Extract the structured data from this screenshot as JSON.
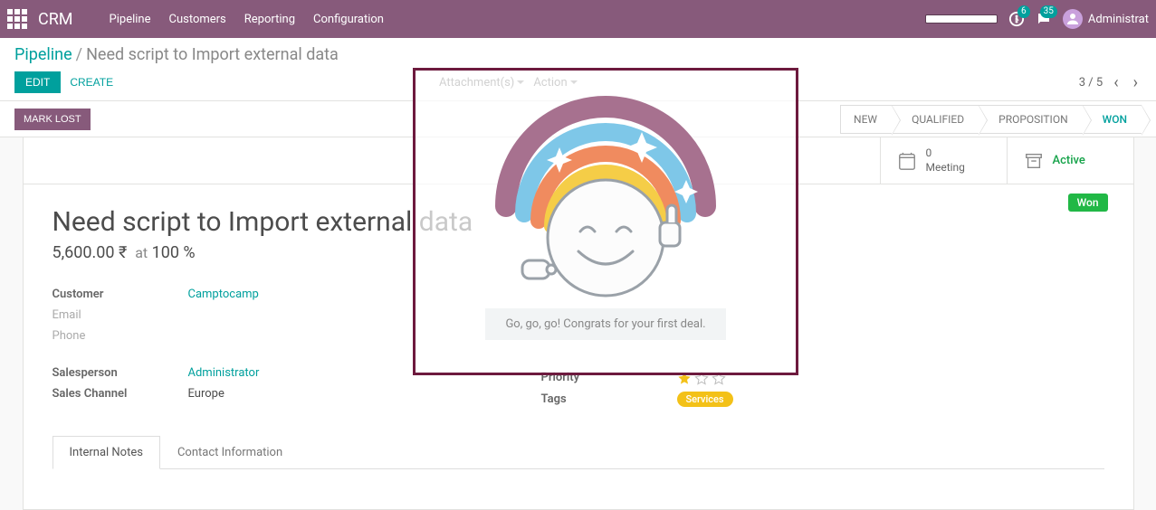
{
  "topnav": {
    "brand": "CRM",
    "menu": [
      "Pipeline",
      "Customers",
      "Reporting",
      "Configuration"
    ],
    "clock_badge": "6",
    "chat_badge": "35",
    "user": "Administrat"
  },
  "breadcrumb": {
    "root": "Pipeline",
    "current": "Need script to Import external data"
  },
  "actions": {
    "edit": "EDIT",
    "create": "CREATE",
    "attachments": "Attachment(s)",
    "action": "Action",
    "mark_lost": "MARK LOST"
  },
  "pager": {
    "pos": "3 / 5"
  },
  "stages": [
    "NEW",
    "QUALIFIED",
    "PROPOSITION",
    "WON"
  ],
  "statbuttons": {
    "meeting_count": "0",
    "meeting_label": "Meeting",
    "active": "Active"
  },
  "record": {
    "won_badge": "Won",
    "title": "Need script to Import external data",
    "amount": "5,600.00 ₹",
    "at": "at",
    "prob": "100 %",
    "fields": {
      "customer_label": "Customer",
      "customer": "Camptocamp",
      "email_label": "Email",
      "phone_label": "Phone",
      "salesperson_label": "Salesperson",
      "salesperson": "Administrator",
      "channel_label": "Sales Channel",
      "channel": "Europe",
      "priority_label": "Priority",
      "tags_label": "Tags",
      "tag": "Services"
    }
  },
  "tabs": [
    "Internal Notes",
    "Contact Information"
  ],
  "congrats": {
    "message": "Go, go, go! Congrats for your first deal."
  }
}
